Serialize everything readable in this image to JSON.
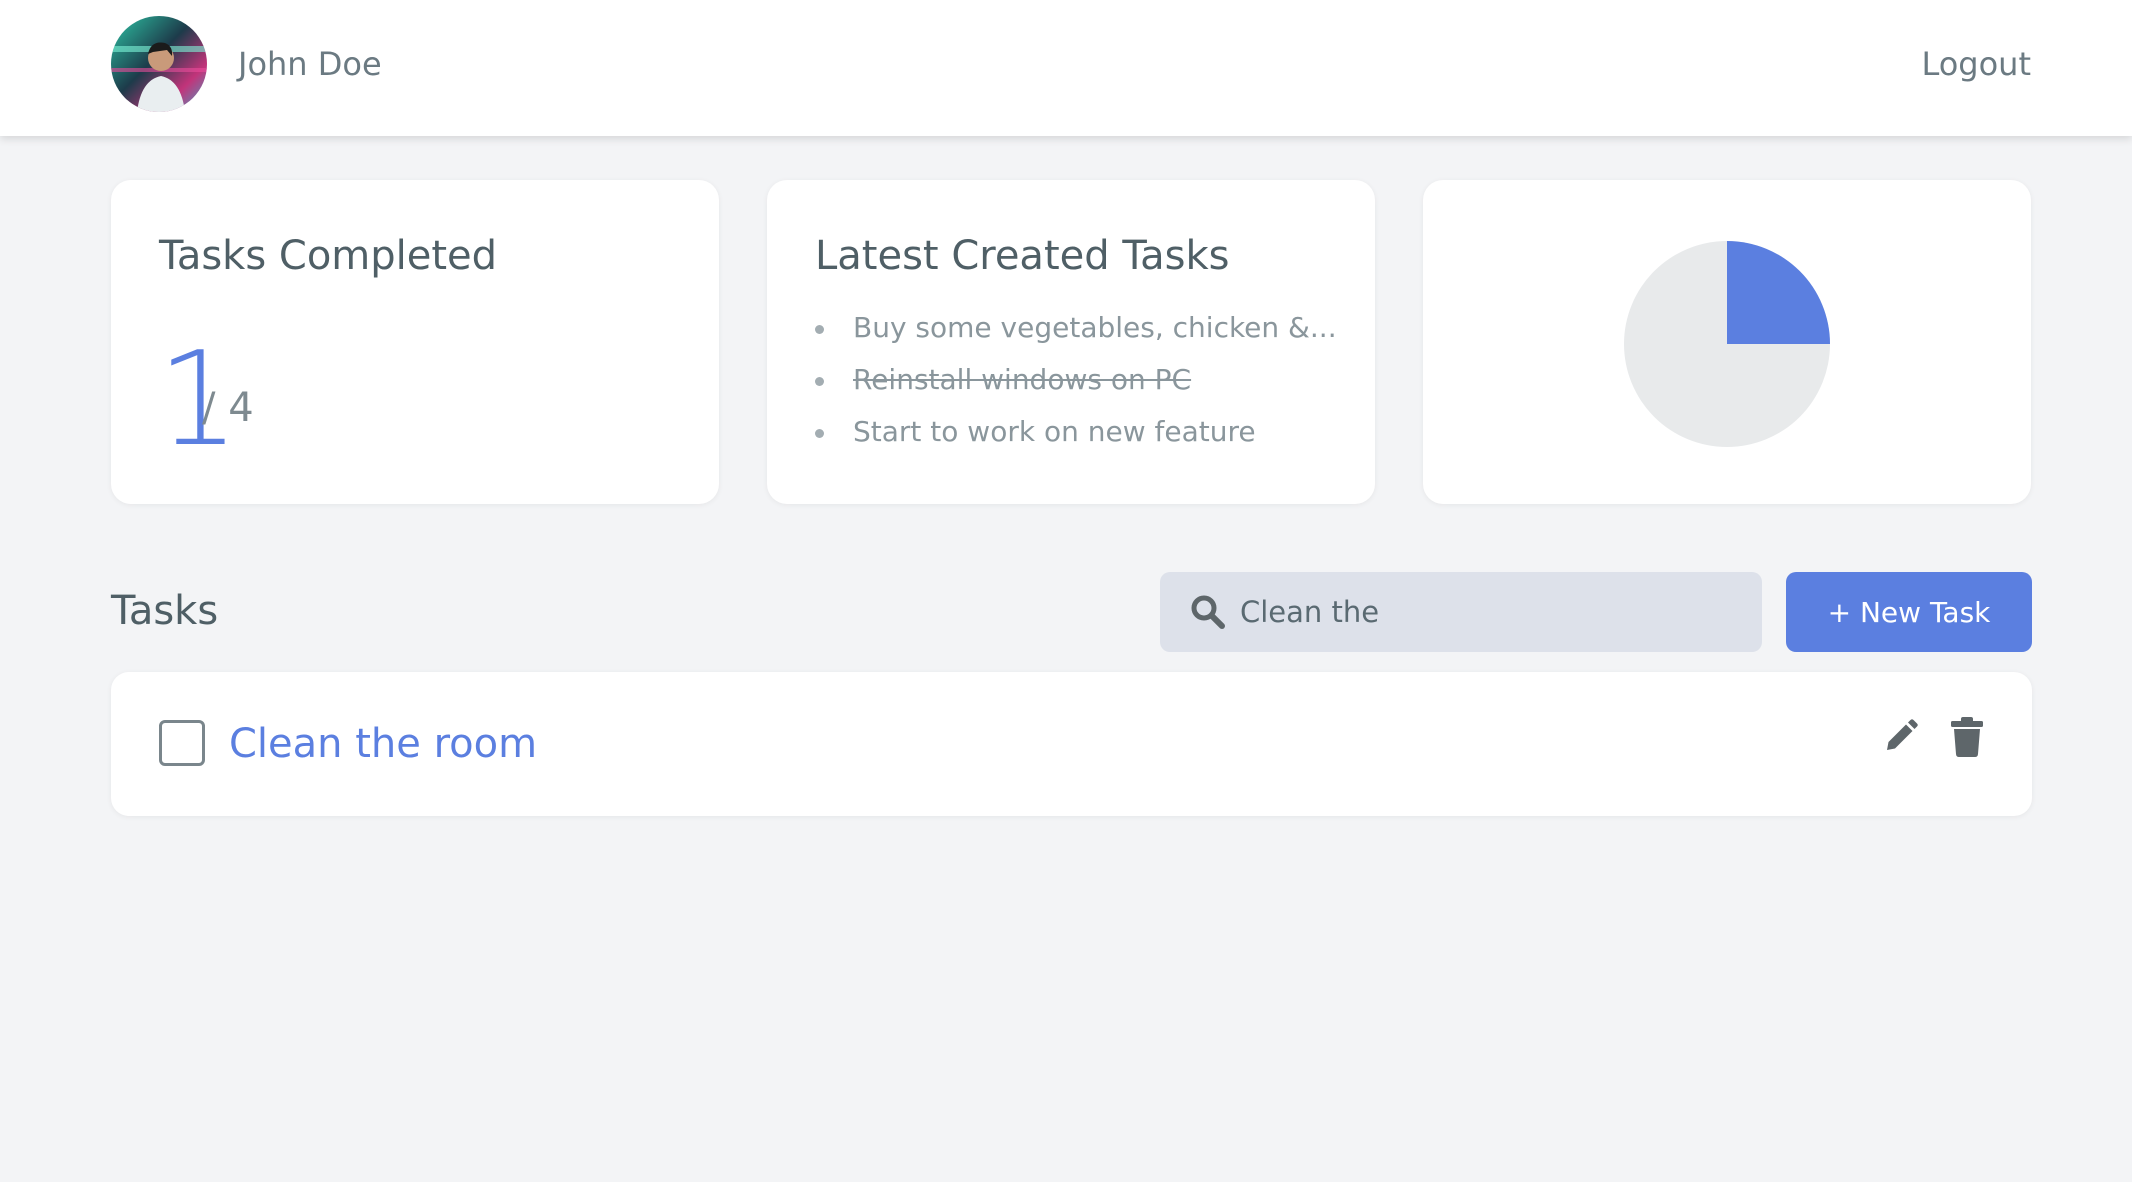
{
  "header": {
    "username": "John Doe",
    "logout_label": "Logout"
  },
  "cards": {
    "completed": {
      "title": "Tasks Completed",
      "completed_count": "1",
      "total_label": "/ 4"
    },
    "latest": {
      "title": "Latest Created Tasks",
      "items": [
        {
          "label": "Buy some vegetables, chicken &...",
          "done": false
        },
        {
          "label": "Reinstall windows on PC",
          "done": true
        },
        {
          "label": "Start to work on new feature",
          "done": false
        }
      ]
    },
    "chart": {
      "completed_fraction": 0.25
    }
  },
  "tasks": {
    "heading": "Tasks",
    "search": {
      "value": "Clean the",
      "icon": "search-icon"
    },
    "new_task_label": "+ New Task",
    "rows": [
      {
        "title": "Clean the room",
        "checked": false
      }
    ]
  },
  "colors": {
    "accent": "#5b7fe0",
    "background": "#f3f4f6",
    "pie_remainder": "#e8eaeb",
    "search_bg": "#dde1ea",
    "icon_gray": "#5e666a"
  }
}
